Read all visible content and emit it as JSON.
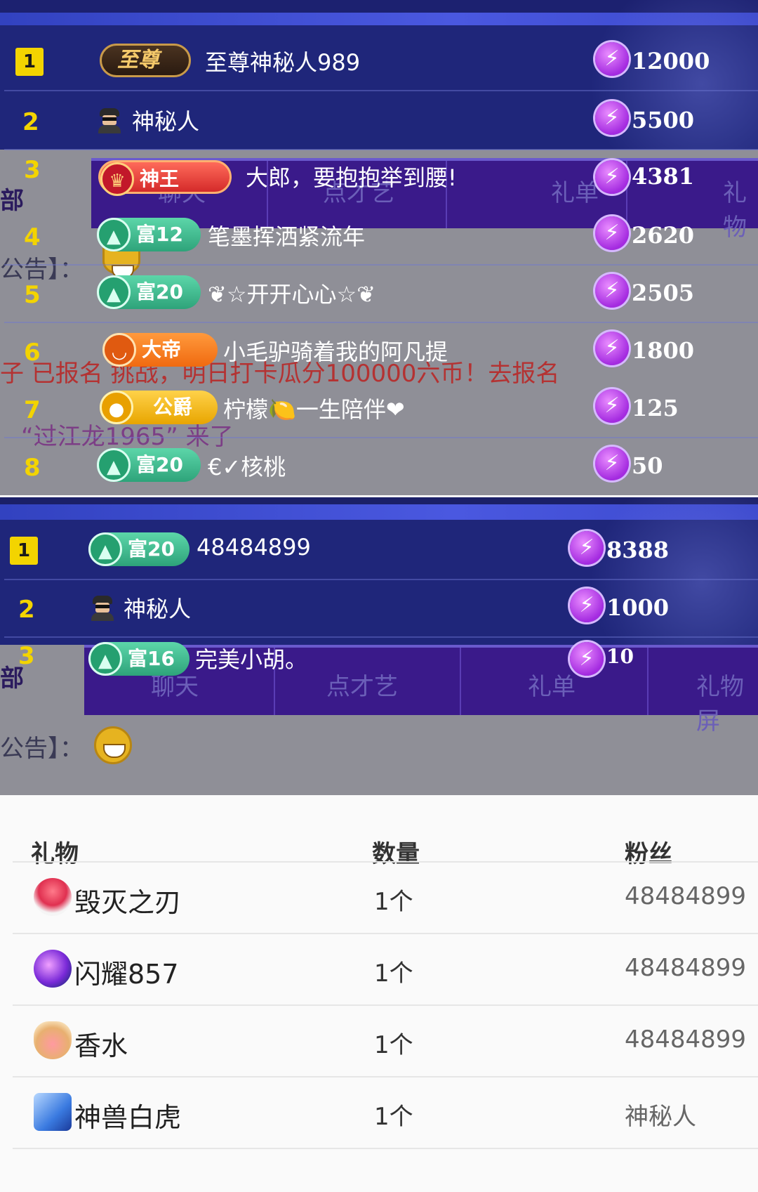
{
  "panel1": {
    "rows": [
      {
        "rank": "1",
        "badge": "至尊",
        "name": "至尊神秘人989",
        "score": "12000"
      },
      {
        "rank": "2",
        "badge": "",
        "name": "神秘人",
        "score": "5500"
      },
      {
        "rank": "3",
        "badge": "神王",
        "name": "大郎，要抱抱举到腰!",
        "score": "4381"
      },
      {
        "rank": "4",
        "badge": "富12",
        "name": "笔墨挥洒紧流年",
        "score": "2620"
      },
      {
        "rank": "5",
        "badge": "富20",
        "name": "❦☆开开心心☆❦",
        "score": "2505"
      },
      {
        "rank": "6",
        "badge": "大帝",
        "name": "小毛驴骑着我的阿凡提",
        "score": "1800"
      },
      {
        "rank": "7",
        "badge": "公爵",
        "name": "柠檬🍋一生陪伴❤",
        "score": "125"
      },
      {
        "rank": "8",
        "badge": "富20",
        "name": "€✓核桃",
        "score": "50"
      }
    ],
    "background": {
      "tabs": [
        "聊天",
        "点才艺",
        "礼单",
        "礼物"
      ],
      "side_label": "部",
      "notice": "公告】：",
      "notice_red": "子 已报名 挑战，明日打卡瓜分100000六币！去报名",
      "chat_purple": "“过江龙1965” 来了"
    }
  },
  "panel2": {
    "rows": [
      {
        "rank": "1",
        "badge": "富20",
        "name": "48484899",
        "score": "8388"
      },
      {
        "rank": "2",
        "badge": "",
        "name": "神秘人",
        "score": "1000"
      },
      {
        "rank": "3",
        "badge": "富16",
        "name": "完美小胡。",
        "score": "10"
      }
    ],
    "background": {
      "tabs": [
        "聊天",
        "点才艺",
        "礼单",
        "礼物屏"
      ],
      "side_label": "部",
      "notice": "公告】："
    }
  },
  "gift_list": {
    "headers": {
      "gift": "礼物",
      "count": "数量",
      "fan": "粉丝"
    },
    "rows": [
      {
        "icon": "rose-icon",
        "gift": "毁灭之刃",
        "count": "1个",
        "fan": "48484899"
      },
      {
        "icon": "orb-icon",
        "gift": "闪耀857",
        "count": "1个",
        "fan": "48484899"
      },
      {
        "icon": "perfume-icon",
        "gift": "香水",
        "count": "1个",
        "fan": "48484899"
      },
      {
        "icon": "white-tiger-icon",
        "gift": "神兽白虎",
        "count": "1个",
        "fan": "神秘人"
      }
    ]
  },
  "colors": {
    "panel_bg": "#1f267a",
    "rank_gold": "#f3d400",
    "overlay_gray": "#8f8f97",
    "tab_purple": "#3a1a8a"
  }
}
